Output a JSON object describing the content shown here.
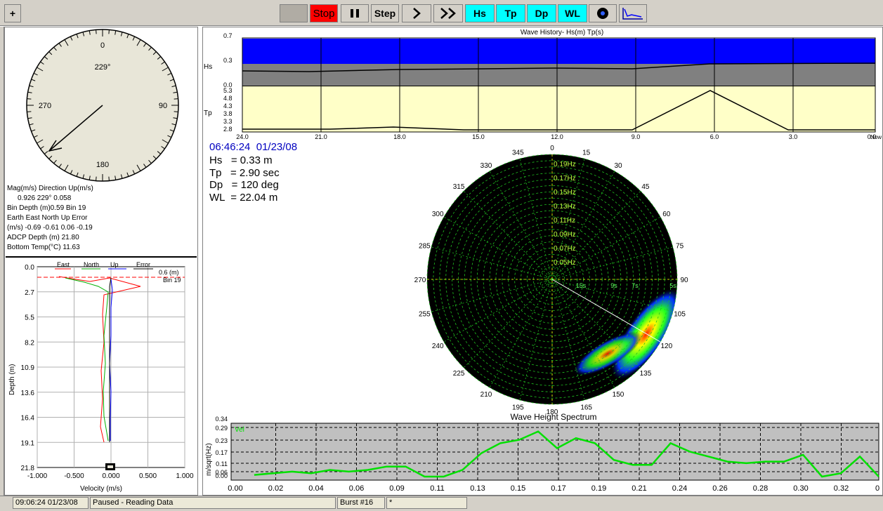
{
  "toolbar": {
    "plus_label": "+",
    "stop_label": "Stop",
    "step_label": "Step",
    "hs_label": "Hs",
    "tp_label": "Tp",
    "dp_label": "Dp",
    "wl_label": "WL"
  },
  "compass": {
    "heading": "229°",
    "n": "0",
    "e": "90",
    "s": "180",
    "w": "270"
  },
  "current_info": {
    "row1": "Mag(m/s)   Direction     Up(m/s)",
    "row2": "0.926          229°       0.058",
    "row3": "Bin Depth (m)0.59    Bin 19",
    "row4": "Earth    East North      Up  Error",
    "row5": "(m/s) -0.69 -0.61  0.06 -0.19",
    "row6": "ADCP Depth (m)          21.80",
    "row7": "Bottom Temp(°C)         11.63"
  },
  "profile": {
    "legend_east": "East",
    "legend_north": "North",
    "legend_up": "Up",
    "legend_error": "Error",
    "marker_depth": "0.6  (m)",
    "marker_bin": "Bin 19",
    "y_ticks": [
      "0.0",
      "2.7",
      "5.5",
      "8.2",
      "10.9",
      "13.6",
      "16.4",
      "19.1",
      "21.8"
    ],
    "x_ticks": [
      "-1.000",
      "-0.500",
      "0.000",
      "0.500",
      "1.000"
    ],
    "ylabel": "Depth (m)",
    "xlabel": "Velocity (m/s)"
  },
  "wave_history": {
    "title": "Wave History-  Hs(m) Tp(s)",
    "hs_label": "Hs",
    "tp_label": "Tp",
    "hs_ticks": [
      "0.7",
      "0.3",
      "0.0"
    ],
    "tp_ticks": [
      "5.3",
      "4.8",
      "4.3",
      "3.8",
      "3.3",
      "2.8"
    ],
    "x_ticks": [
      "24.0",
      "21.0",
      "18.0",
      "15.0",
      "12.0",
      "9.0",
      "6.0",
      "3.0",
      "0.0"
    ],
    "x_end": "Now"
  },
  "readout": {
    "timestamp": "06:46:24  01/23/08",
    "hs": "Hs   = 0.33 m",
    "tp": "Tp   = 2.90 sec",
    "dp": "Dp   = 120 deg",
    "wl": "WL  = 22.04 m"
  },
  "polar": {
    "angles": [
      "0",
      "15",
      "30",
      "45",
      "60",
      "75",
      "90",
      "105",
      "120",
      "135",
      "150",
      "165",
      "180",
      "195",
      "210",
      "225",
      "240",
      "255",
      "270",
      "285",
      "300",
      "315",
      "330",
      "345"
    ],
    "freq_rings": [
      "0.19Hz",
      "0.17Hz",
      "0.15Hz",
      "0.13Hz",
      "0.11Hz",
      "0.09Hz",
      "0.07Hz",
      "0.05Hz"
    ],
    "period_marks": [
      "15s",
      "9s",
      "7s",
      "5s"
    ]
  },
  "spectrum": {
    "title": "Wave Height Spectrum",
    "legend": "Vel",
    "ylabel": "m/sqrt(Hz)",
    "y_ticks": [
      "0.34",
      "0.29",
      "0.23",
      "0.17",
      "0.11",
      "0.06",
      "0.00"
    ],
    "x_ticks": [
      "0.00",
      "0.02",
      "0.04",
      "0.06",
      "0.09",
      "0.11",
      "0.13",
      "0.15",
      "0.17",
      "0.19",
      "0.21",
      "0.24",
      "0.26",
      "0.28",
      "0.30",
      "0.32",
      "0"
    ]
  },
  "chart_data": {
    "type": "line",
    "title": "Wave Height Spectrum",
    "xlabel": "",
    "ylabel": "m/sqrt(Hz)",
    "xlim": [
      0.0,
      0.34
    ],
    "ylim": [
      0.0,
      0.34
    ],
    "series": [
      {
        "name": "Vel",
        "x": [
          0.01,
          0.02,
          0.03,
          0.04,
          0.05,
          0.06,
          0.07,
          0.08,
          0.09,
          0.1,
          0.11,
          0.12,
          0.13,
          0.14,
          0.15,
          0.16,
          0.17,
          0.18,
          0.19,
          0.2,
          0.21,
          0.22,
          0.23,
          0.24,
          0.25,
          0.26,
          0.27,
          0.28,
          0.29,
          0.3,
          0.31,
          0.32,
          0.33,
          0.34
        ],
        "values": [
          0.01,
          0.02,
          0.03,
          0.02,
          0.04,
          0.03,
          0.04,
          0.06,
          0.06,
          0.0,
          0.0,
          0.04,
          0.14,
          0.2,
          0.22,
          0.27,
          0.17,
          0.23,
          0.2,
          0.1,
          0.07,
          0.07,
          0.2,
          0.15,
          0.12,
          0.09,
          0.08,
          0.09,
          0.09,
          0.13,
          0.0,
          0.02,
          0.12,
          0.0
        ]
      }
    ]
  },
  "statusbar": {
    "time": "09:06:24  01/23/08",
    "state": "Paused - Reading Data",
    "burst": "Burst #16",
    "extra": "*"
  }
}
